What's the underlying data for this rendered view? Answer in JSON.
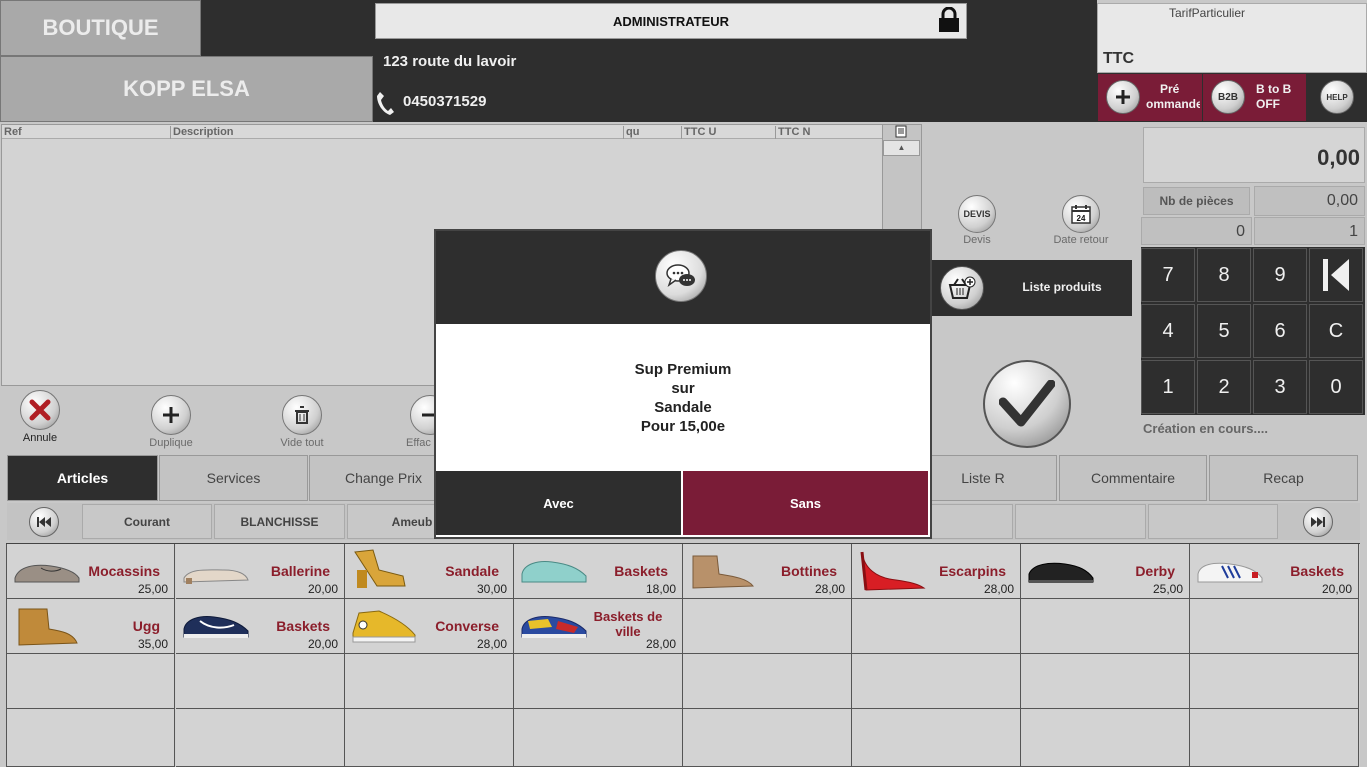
{
  "header": {
    "store": "BOUTIQUE",
    "client": "KOPP ELSA",
    "user": "ADMINISTRATEUR",
    "address": "123 route du lavoir",
    "phone": "0450371529",
    "tarif": "TarifParticulier",
    "ttc": "TTC",
    "precommande_label_1": "Pré",
    "precommande_label_2": "ommande",
    "b2b_icon": "B2B",
    "b2b_label_1": "B to B",
    "b2b_label_2": "OFF",
    "help_icon": "HELP"
  },
  "table": {
    "columns": [
      "Ref",
      "Description",
      "qu",
      "TTC U",
      "TTC N"
    ]
  },
  "actions": {
    "annule": "Annule",
    "duplique": "Duplique",
    "vide_tout": "Vide tout",
    "efface": "Effac"
  },
  "side": {
    "devis_icon": "DEVIS",
    "devis": "Devis",
    "date_icon": "24",
    "date_retour": "Date retour",
    "liste_produits": "Liste produits"
  },
  "totals": {
    "total": "0,00",
    "nb_pieces_label": "Nb de pièces",
    "nb_pieces_value": "0,00",
    "field_left": "0",
    "field_right": "1"
  },
  "keypad": [
    "7",
    "8",
    "9",
    "4",
    "5",
    "6",
    "C",
    "1",
    "2",
    "3",
    "0"
  ],
  "status": "Création en cours....",
  "tabs": [
    "Articles",
    "Services",
    "Change Prix",
    "Liste R",
    "Commentaire",
    "Recap"
  ],
  "subtabs": [
    "Courant",
    "BLANCHISSE",
    "Ameub"
  ],
  "products": [
    {
      "name": "Mocassins",
      "price": "25,00"
    },
    {
      "name": "Ballerine",
      "price": "20,00"
    },
    {
      "name": "Sandale",
      "price": "30,00"
    },
    {
      "name": "Baskets",
      "price": "18,00"
    },
    {
      "name": "Bottines",
      "price": "28,00"
    },
    {
      "name": "Escarpins",
      "price": "28,00"
    },
    {
      "name": "Derby",
      "price": "25,00"
    },
    {
      "name": "Baskets",
      "price": "20,00"
    },
    {
      "name": "Ugg",
      "price": "35,00"
    },
    {
      "name": "Baskets",
      "price": "20,00"
    },
    {
      "name": "Converse",
      "price": "28,00"
    },
    {
      "name": "Baskets de ville",
      "price": "28,00"
    }
  ],
  "modal": {
    "line1": "Sup Premium",
    "line2": "sur",
    "line3": "Sandale",
    "line4": "Pour 15,00e",
    "avec": "Avec",
    "sans": "Sans"
  },
  "colors": {
    "accent": "#7a1c37",
    "dark": "#2e2e2e",
    "product_name": "#8b1e2b"
  }
}
